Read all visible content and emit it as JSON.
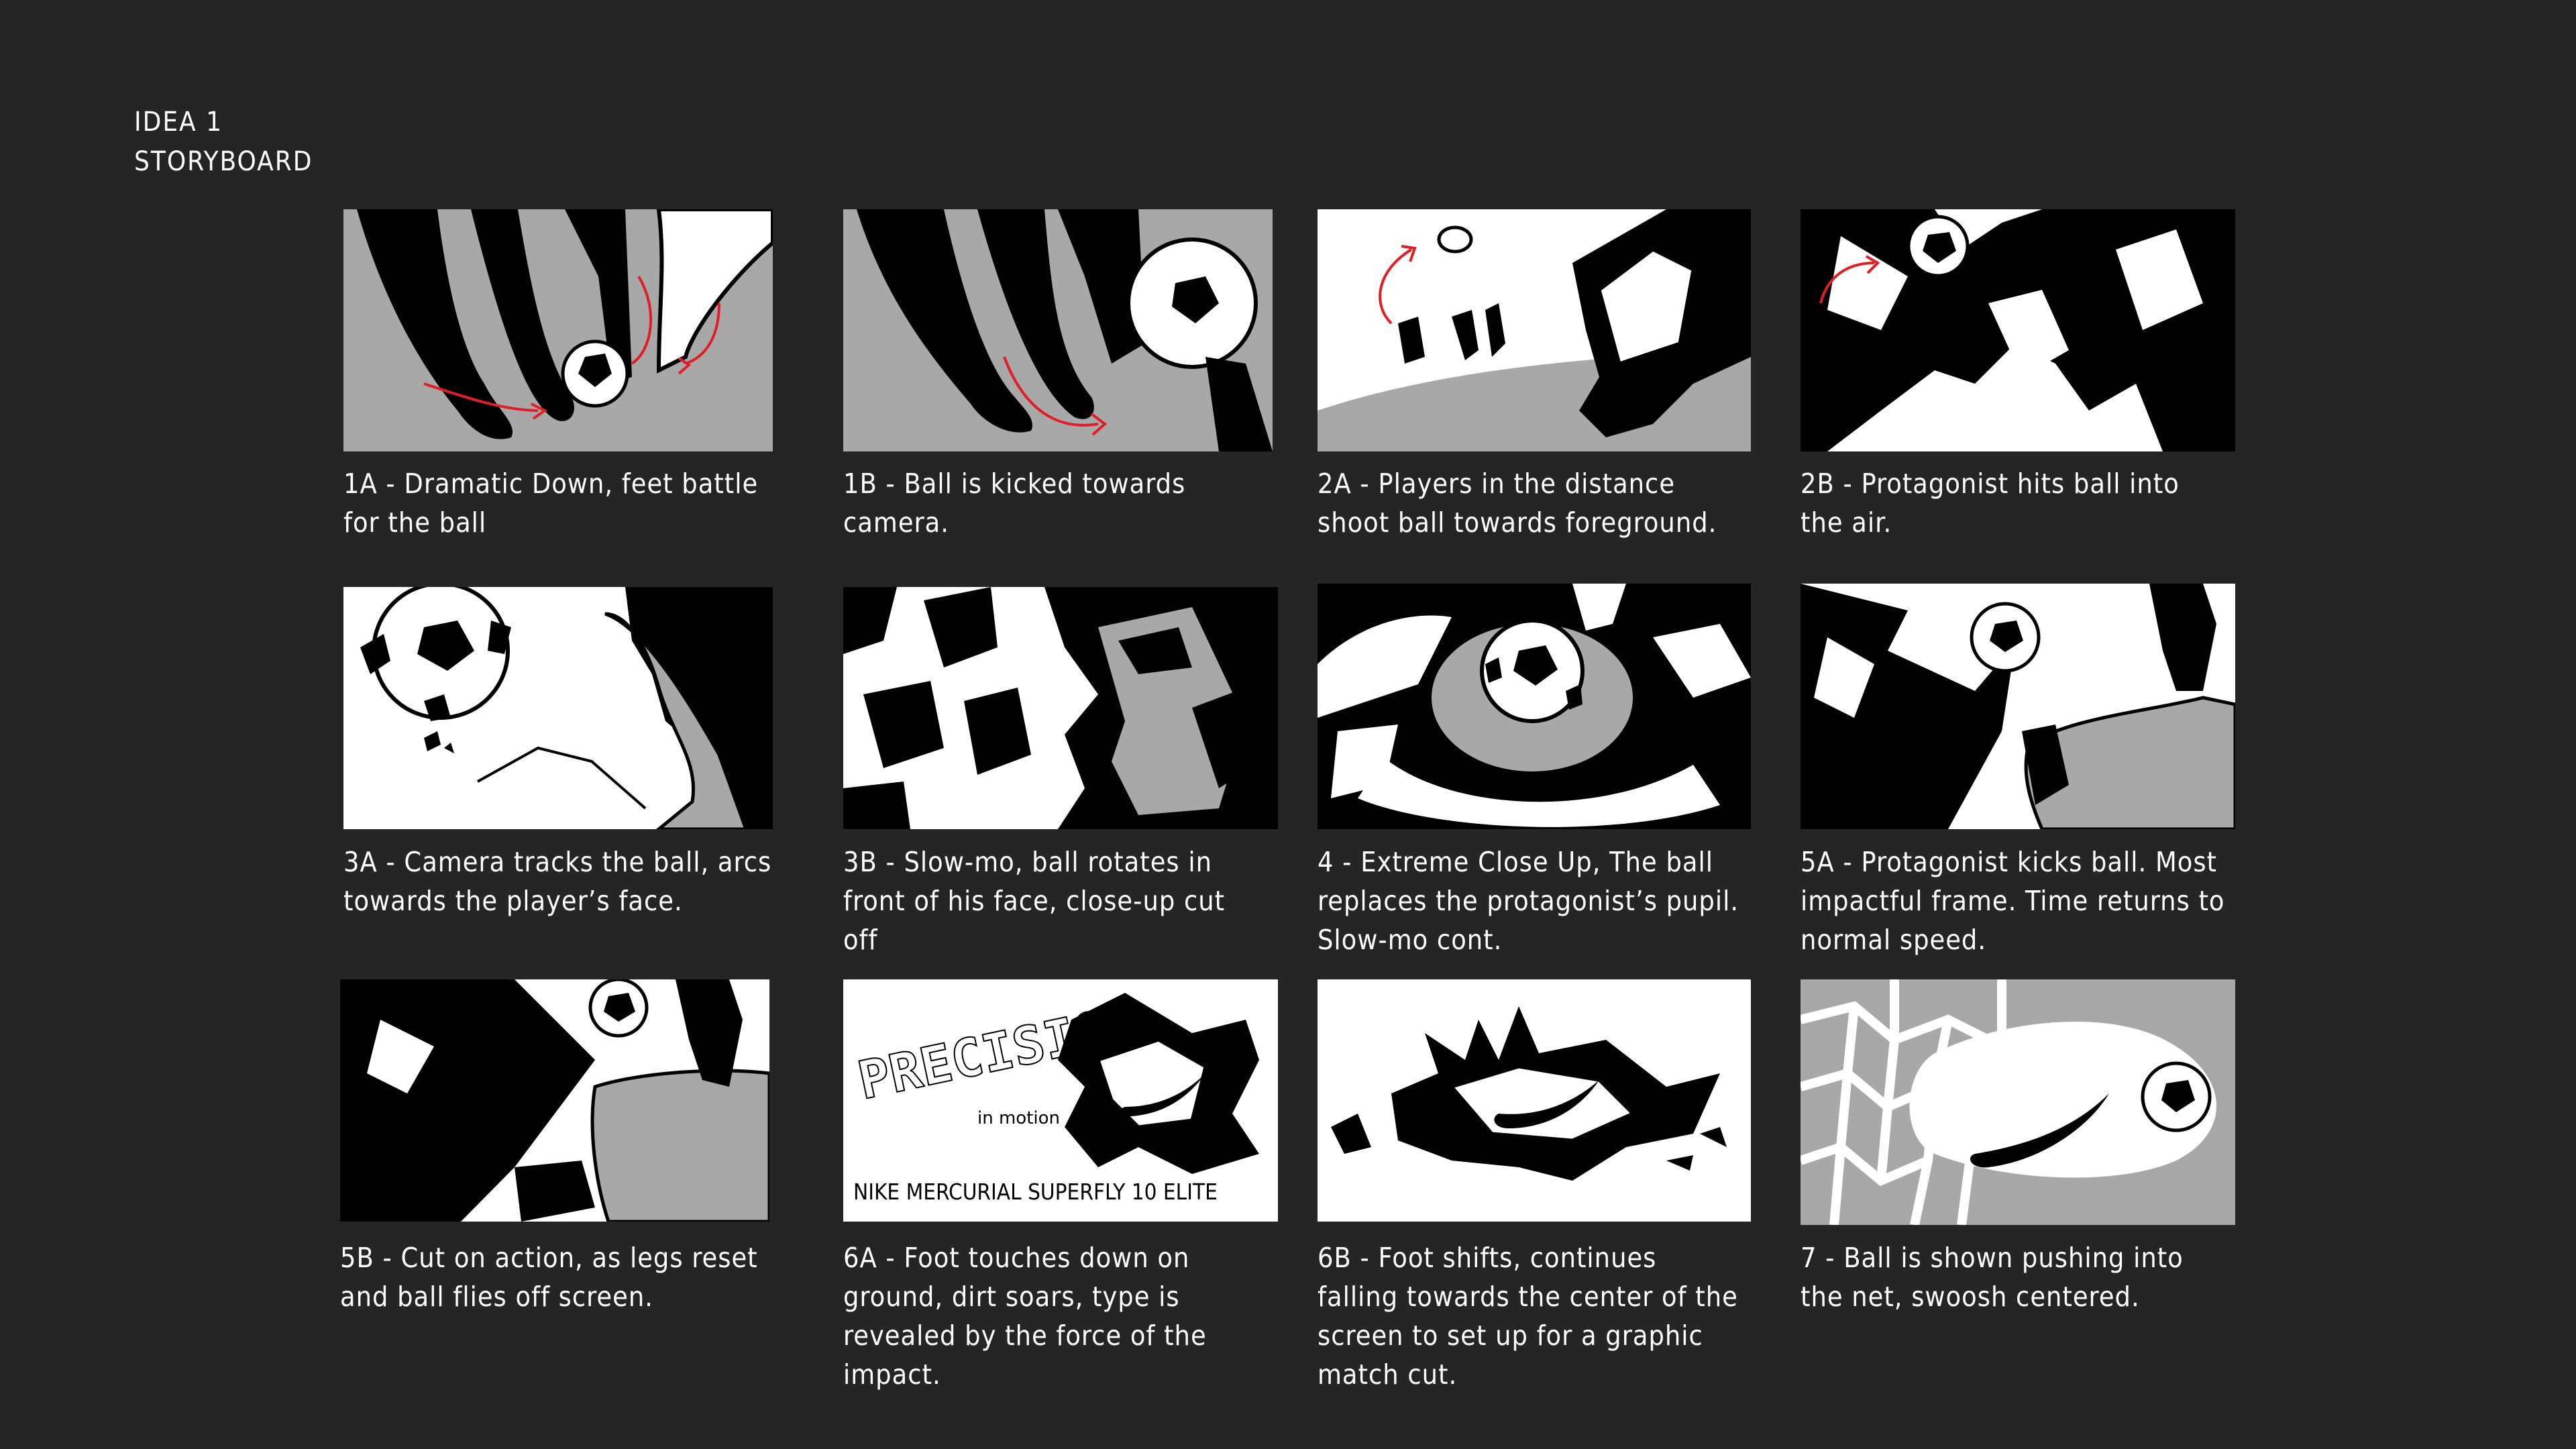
{
  "header": {
    "line1": "IDEA 1",
    "line2": "STORYBOARD"
  },
  "panels": [
    {
      "id": "1a",
      "lines": [
        "1A - Dramatic Down, feet battle",
        "for the ball"
      ]
    },
    {
      "id": "1b",
      "lines": [
        "1B - Ball is kicked towards",
        "camera."
      ]
    },
    {
      "id": "2a",
      "lines": [
        "2A - Players in the distance",
        "shoot ball towards foreground."
      ]
    },
    {
      "id": "2b",
      "lines": [
        "2B - Protagonist hits ball into",
        "the air."
      ]
    },
    {
      "id": "3a",
      "lines": [
        "3A - Camera tracks the ball, arcs",
        "towards the player’s face."
      ]
    },
    {
      "id": "3b",
      "lines": [
        "3B - Slow-mo, ball rotates in",
        "front of his face, close-up cut",
        "off"
      ]
    },
    {
      "id": "4",
      "lines": [
        "4 - Extreme Close Up, The ball",
        "replaces the protagonist’s pupil.",
        "Slow-mo cont."
      ]
    },
    {
      "id": "5a",
      "lines": [
        "5A - Protagonist kicks ball. Most",
        "impactful frame. Time returns to",
        "normal speed."
      ]
    },
    {
      "id": "5b",
      "lines": [
        "5B - Cut on action, as legs reset",
        "and ball flies off screen."
      ]
    },
    {
      "id": "6a",
      "lines": [
        "6A - Foot touches down on",
        "ground, dirt soars, type is",
        "revealed by the force of the",
        "impact."
      ]
    },
    {
      "id": "6b",
      "lines": [
        "6B - Foot shifts, continues",
        "falling towards the center of the",
        "screen to set up for a graphic",
        "match cut."
      ]
    },
    {
      "id": "7",
      "lines": [
        "7 - Ball is shown pushing into",
        "the net, swoosh centered."
      ]
    }
  ],
  "frame_6a_text": {
    "word1": "PRECISION",
    "word2": "in motion",
    "word3": "NIKE MERCURIAL SUPERFLY 10 ELITE"
  },
  "colors": {
    "background": "#252525",
    "ink": "#000000",
    "paper": "#ffffff",
    "gray": "#a8a8a8",
    "accent_red": "#e01e25"
  }
}
